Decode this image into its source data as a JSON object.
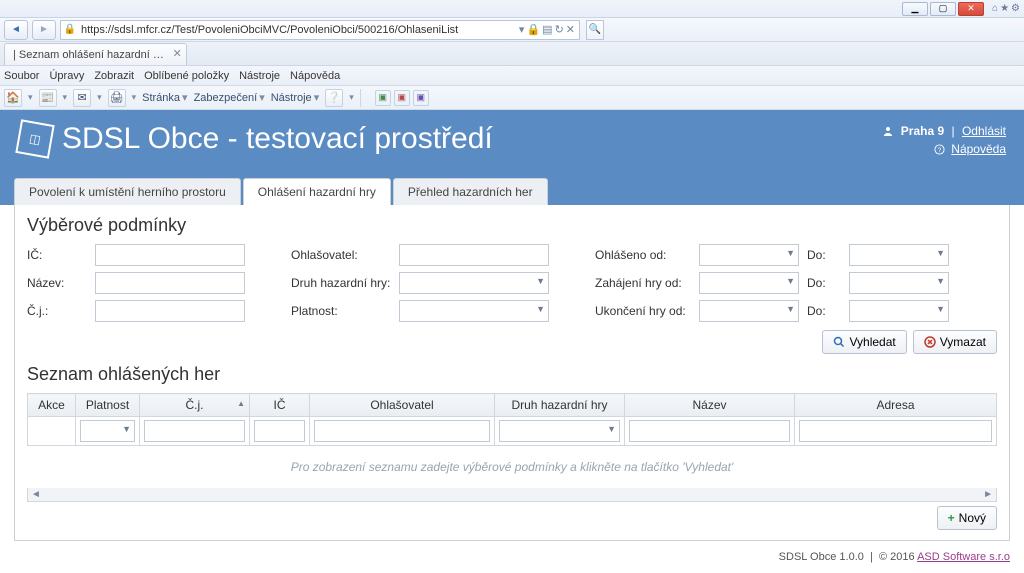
{
  "browser": {
    "win_controls": {
      "min": "▁",
      "max": "▢",
      "close": "✕",
      "home": "⌂",
      "star": "★",
      "gear": "⚙"
    },
    "url": "https://sdsl.mfcr.cz/Test/PovoleniObciMVC/PovoleniObci/500216/OhlaseniList",
    "url_suffix_label": "▾   🔒 ",
    "tab_label": "| Seznam ohlášení hazardní …",
    "menu": {
      "soubor": "Soubor",
      "upravy": "Úpravy",
      "zobrazit": "Zobrazit",
      "oblibene": "Oblíbené položky",
      "nastroje": "Nástroje",
      "napoveda": "Nápověda"
    },
    "ie_toolbar": {
      "stranka": "Stránka",
      "zabezpeceni": "Zabezpečení",
      "nastroje2": "Nástroje"
    }
  },
  "header": {
    "title": "SDSL Obce - testovací prostředí",
    "user_label": "Praha 9",
    "logout": "Odhlásit",
    "help": "Nápověda"
  },
  "tabs": {
    "t1": "Povolení k umístění herního prostoru",
    "t2": "Ohlášení hazardní hry",
    "t3": "Přehled hazardních her"
  },
  "filters": {
    "title": "Výběrové podmínky",
    "ic": "IČ:",
    "nazev": "Název:",
    "cj": "Č.j.:",
    "ohlasovatel": "Ohlašovatel:",
    "druh": "Druh hazardní hry:",
    "platnost": "Platnost:",
    "ohlaseno_od": "Ohlášeno od:",
    "zahajeni_od": "Zahájení hry od:",
    "ukonceni_od": "Ukončení hry od:",
    "do": "Do:"
  },
  "buttons": {
    "search": "Vyhledat",
    "clear": "Vymazat",
    "new": "Nový"
  },
  "list": {
    "title": "Seznam ohlášených her",
    "cols": {
      "akce": "Akce",
      "platnost": "Platnost",
      "cj": "Č.j.",
      "ic": "IČ",
      "ohlasovatel": "Ohlašovatel",
      "druh": "Druh hazardní hry",
      "nazev": "Název",
      "adresa": "Adresa"
    },
    "empty": "Pro zobrazení seznamu zadejte výběrové podmínky a klikněte na tlačítko 'Vyhledat'"
  },
  "footer": {
    "product": "SDSL Obce 1.0.0",
    "copyright": "© 2016",
    "vendor": "ASD Software s.r.o"
  }
}
